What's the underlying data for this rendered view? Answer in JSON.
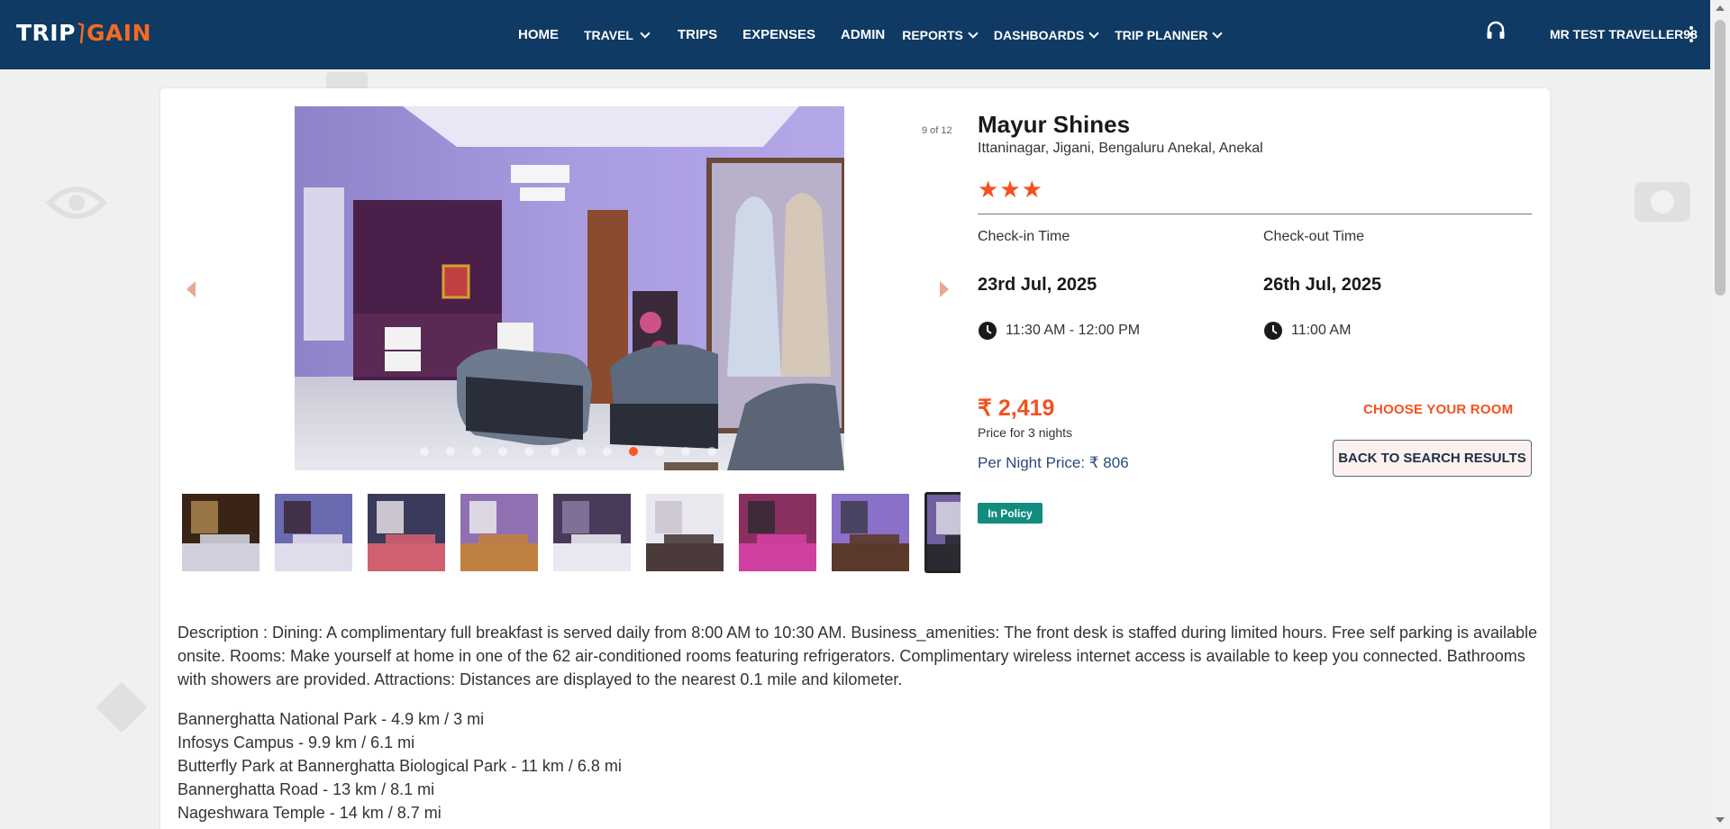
{
  "header": {
    "logo_left": "TRIP",
    "logo_right": "GAIN",
    "nav": [
      {
        "label": "HOME",
        "dropdown": false
      },
      {
        "label": "TRAVEL",
        "dropdown": true
      },
      {
        "label": "TRIPS",
        "dropdown": false
      },
      {
        "label": "EXPENSES",
        "dropdown": false
      },
      {
        "label": "ADMIN",
        "dropdown": false
      },
      {
        "label": "REPORTS",
        "dropdown": true
      },
      {
        "label": "DASHBOARDS",
        "dropdown": true
      },
      {
        "label": "TRIP PLANNER",
        "dropdown": true
      }
    ],
    "support_icon": "headset-icon",
    "user_name": "MR TEST TRAVELLER98",
    "menu_icon": "kebab-menu-icon",
    "bg_color": "#0f3a63",
    "accent_color": "#f36b21"
  },
  "gallery": {
    "counter": "9 of 12",
    "total_images": 12,
    "active_index": 9,
    "thumbnail_count": 9
  },
  "hotel": {
    "name": "Mayur Shines",
    "address": "Ittaninagar, Jigani, Bengaluru Anekal, Anekal",
    "star_rating": 3,
    "checkin_label": "Check-in Time",
    "checkout_label": "Check-out Time",
    "checkin_date": "23rd Jul, 2025",
    "checkout_date": "26th Jul, 2025",
    "checkin_time": "11:30 AM - 12:00 PM",
    "checkout_time": "11:00 AM",
    "price": "₹ 2,419",
    "price_note": "Price for 3 nights",
    "per_night": "Per Night Price: ₹ 806",
    "choose_room": "CHOOSE YOUR ROOM",
    "back_button": "BACK TO SEARCH RESULTS",
    "policy_badge": "In Policy",
    "price_color": "#f4511e",
    "policy_color": "#128c7e"
  },
  "description": "Description : Dining: A complimentary full breakfast is served daily from 8:00 AM to 10:30 AM. Business_amenities: The front desk is staffed during limited hours. Free self parking is available onsite. Rooms: Make yourself at home in one of the 62 air-conditioned rooms featuring refrigerators. Complimentary wireless internet access is available to keep you connected. Bathrooms with showers are provided. Attractions: Distances are displayed to the nearest 0.1 mile and kilometer.",
  "attractions": [
    "Bannerghatta National Park - 4.9 km / 3 mi",
    "Infosys Campus - 9.9 km / 6.1 mi",
    "Butterfly Park at Bannerghatta Biological Park - 11 km / 6.8 mi",
    "Bannerghatta Road - 13 km / 8.1 mi",
    "Nageshwara Temple - 14 km / 8.7 mi"
  ]
}
